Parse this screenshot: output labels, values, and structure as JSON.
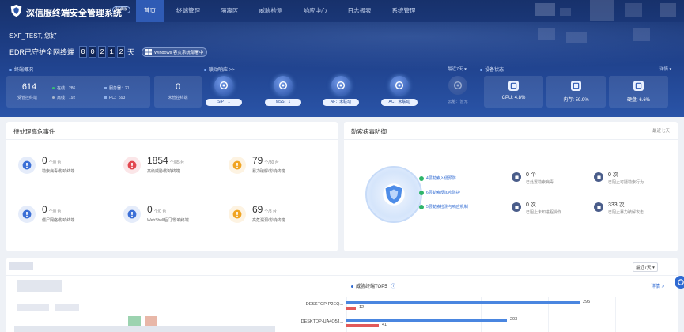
{
  "header": {
    "app_title": "深信服终端安全管理系统",
    "version_badge": "标准版",
    "nav": [
      "首页",
      "终端管理",
      "隔离区",
      "威胁检测",
      "响应中心",
      "日志报表",
      "系统管理"
    ],
    "active_nav": 0
  },
  "welcome": "SXF_TEST, 您好",
  "protect": {
    "prefix": "EDR已守护全网终端",
    "digits": [
      "0",
      "0",
      "2",
      "1",
      "2"
    ],
    "suffix": "天",
    "notice": "Windows 容灾系统部署中"
  },
  "terminal_overview": {
    "label": "终端概况",
    "total": "614",
    "total_label": "受管控终端",
    "online": "在线：286",
    "offline": "离线：192",
    "server": "服务器：21",
    "pc": "PC：593",
    "unmanaged": "0",
    "unmanaged_label": "未管控终端"
  },
  "linkage": {
    "label": "联动响应 >>",
    "range": "最近7天",
    "items": [
      {
        "label": "SIP：1",
        "active": true
      },
      {
        "label": "MSS：1",
        "active": true
      },
      {
        "label": "AF：未联动",
        "active": true
      },
      {
        "label": "AC：未联动",
        "active": true
      },
      {
        "label": "云脑：暂无",
        "active": false
      }
    ]
  },
  "device_status": {
    "label": "设备状态",
    "detail": "详情",
    "items": [
      {
        "label": "CPU: 4.8%",
        "icon": "cpu-icon"
      },
      {
        "label": "内存: 59.9%",
        "icon": "memory-icon"
      },
      {
        "label": "硬盘: 6.6%",
        "icon": "disk-icon"
      }
    ]
  },
  "pending": {
    "title": "待处理高危事件",
    "events": [
      {
        "num": "0",
        "sub": "个/0 台",
        "name": "勒索病毒/影响终端",
        "color": "#3b6fd6"
      },
      {
        "num": "1854",
        "sub": "个/85 台",
        "name": "高级威胁/影响终端",
        "color": "#e2474f"
      },
      {
        "num": "79",
        "sub": "个/30 台",
        "name": "暴力破解/影响终端",
        "color": "#f0a423"
      },
      {
        "num": "0",
        "sub": "个/0 台",
        "name": "僵尸网络/影响终端",
        "color": "#3b6fd6"
      },
      {
        "num": "0",
        "sub": "个/0 台",
        "name": "WebShell后门/影响终端",
        "color": "#3b6fd6"
      },
      {
        "num": "69",
        "sub": "个/3 台",
        "name": "高危漏洞/影响终端",
        "color": "#f0a423"
      }
    ]
  },
  "ransom": {
    "title": "勒索病毒防御",
    "range": "最近七天",
    "features": [
      "4层勒索入侵预防",
      "6层勒索反加密防护",
      "5层勒索检测与响应机制"
    ],
    "stats": [
      {
        "num": "0 个",
        "desc": "已处置勒索病毒"
      },
      {
        "num": "0 次",
        "desc": "已阻止可疑勒索行为"
      },
      {
        "num": "0 次",
        "desc": "已阻止未知进程操作"
      },
      {
        "num": "333 次",
        "desc": "已阻止暴力破解攻击"
      }
    ]
  },
  "bottom": {
    "range": "最近7天",
    "tops_title": "威胁终端TOP5",
    "detail": "详情 >"
  },
  "chart_data": {
    "type": "bar",
    "title": "威胁终端TOP5",
    "categories": [
      "DESKTOP-P2EQ...",
      "DESKTOP-UA4O5J..."
    ],
    "series": [
      {
        "values": [
          295,
          203
        ],
        "color": "#4a86e0"
      },
      {
        "values": [
          12,
          41
        ],
        "color": "#e25a5a"
      }
    ],
    "xlim": [
      0,
      340
    ]
  }
}
